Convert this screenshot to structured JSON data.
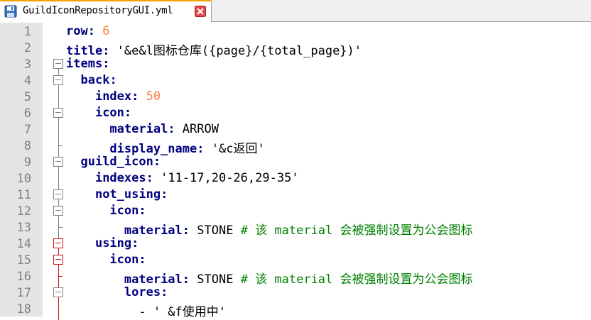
{
  "tab": {
    "title": "GuildIconRepositoryGUI.yml"
  },
  "lines": [
    {
      "num": "1",
      "indent": "",
      "key": "row",
      "sep": ": ",
      "num_val": "6",
      "str": "",
      "comment": ""
    },
    {
      "num": "2",
      "indent": "",
      "key": "title",
      "sep": ": ",
      "num_val": "",
      "str": "'&e&l图标仓库({page}/{total_page})'",
      "comment": ""
    },
    {
      "num": "3",
      "indent": "",
      "key": "items",
      "sep": ":",
      "num_val": "",
      "str": "",
      "comment": ""
    },
    {
      "num": "4",
      "indent": "  ",
      "key": "back",
      "sep": ":",
      "num_val": "",
      "str": "",
      "comment": ""
    },
    {
      "num": "5",
      "indent": "    ",
      "key": "index",
      "sep": ": ",
      "num_val": "50",
      "str": "",
      "comment": ""
    },
    {
      "num": "6",
      "indent": "    ",
      "key": "icon",
      "sep": ":",
      "num_val": "",
      "str": "",
      "comment": ""
    },
    {
      "num": "7",
      "indent": "      ",
      "key": "material",
      "sep": ": ",
      "num_val": "",
      "str": "ARROW",
      "comment": ""
    },
    {
      "num": "8",
      "indent": "      ",
      "key": "display_name",
      "sep": ": ",
      "num_val": "",
      "str": "'&c返回'",
      "comment": ""
    },
    {
      "num": "9",
      "indent": "  ",
      "key": "guild_icon",
      "sep": ":",
      "num_val": "",
      "str": "",
      "comment": ""
    },
    {
      "num": "10",
      "indent": "    ",
      "key": "indexes",
      "sep": ": ",
      "num_val": "",
      "str": "'11-17,20-26,29-35'",
      "comment": ""
    },
    {
      "num": "11",
      "indent": "    ",
      "key": "not_using",
      "sep": ":",
      "num_val": "",
      "str": "",
      "comment": ""
    },
    {
      "num": "12",
      "indent": "      ",
      "key": "icon",
      "sep": ":",
      "num_val": "",
      "str": "",
      "comment": ""
    },
    {
      "num": "13",
      "indent": "        ",
      "key": "material",
      "sep": ": ",
      "num_val": "",
      "str": "STONE ",
      "comment": "# 该 material 会被强制设置为公会图标"
    },
    {
      "num": "14",
      "indent": "    ",
      "key": "using",
      "sep": ":",
      "num_val": "",
      "str": "",
      "comment": ""
    },
    {
      "num": "15",
      "indent": "      ",
      "key": "icon",
      "sep": ":",
      "num_val": "",
      "str": "",
      "comment": ""
    },
    {
      "num": "16",
      "indent": "        ",
      "key": "material",
      "sep": ": ",
      "num_val": "",
      "str": "STONE ",
      "comment": "# 该 material 会被强制设置为公会图标"
    },
    {
      "num": "17",
      "indent": "        ",
      "key": "lores",
      "sep": ":",
      "num_val": "",
      "str": "",
      "comment": ""
    },
    {
      "num": "18",
      "indent": "          ",
      "key": "",
      "sep": "",
      "num_val": "",
      "str": "- ' &f使用中'",
      "comment": ""
    }
  ],
  "colors": {
    "key": "#000080",
    "number": "#ff8040",
    "comment": "#008000",
    "fold_black": "#808080",
    "fold_red": "#d01010",
    "gutter": "#e4e4e4",
    "tab_accent": "#f4a300"
  }
}
